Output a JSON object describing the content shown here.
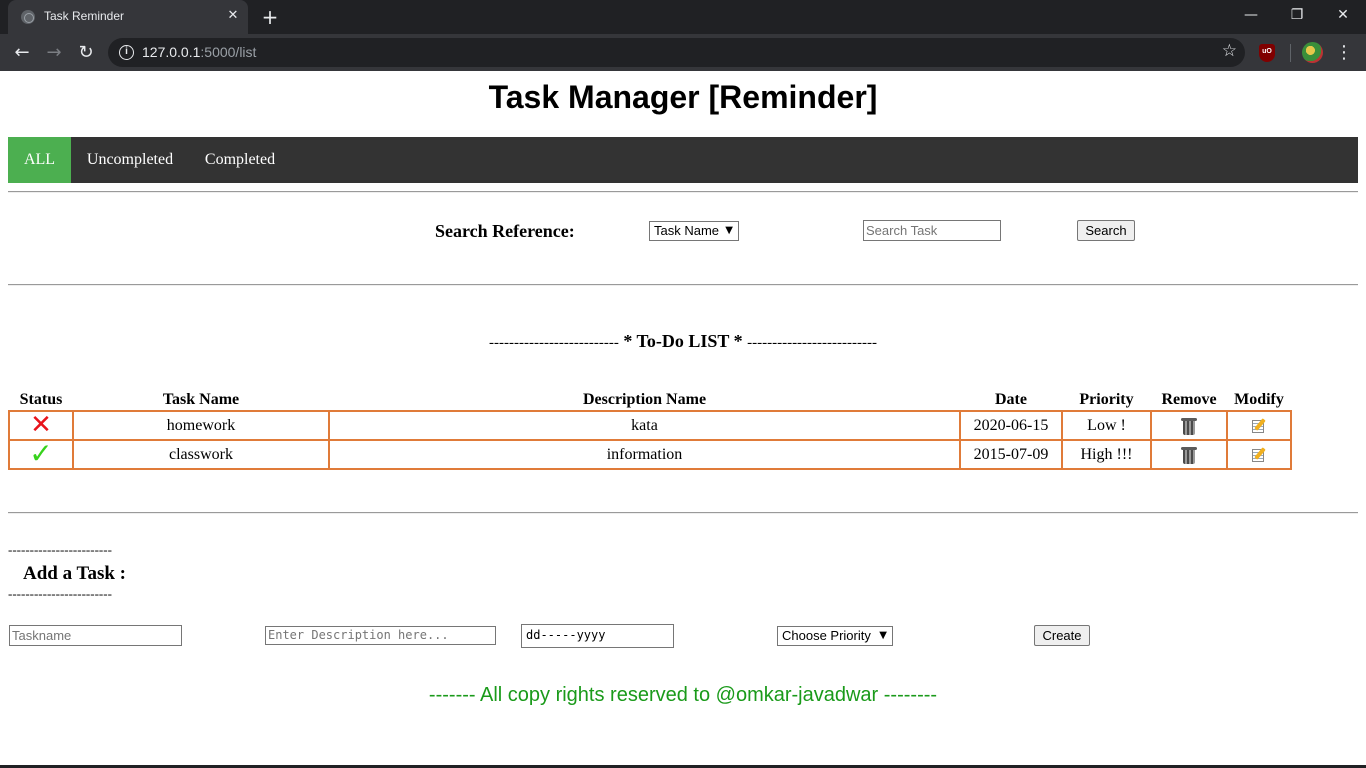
{
  "browser": {
    "tab_title": "Task Reminder",
    "tab_close": "✕",
    "new_tab": "+",
    "window": {
      "minimize": "—",
      "restore": "❐",
      "close": "✕"
    },
    "url_host": "127.0.0.1",
    "url_path": ":5000/list",
    "extension_label": "uO"
  },
  "page": {
    "title": "Task Manager [Reminder]",
    "nav": [
      {
        "label": "ALL",
        "active": true
      },
      {
        "label": "Uncompleted",
        "active": false
      },
      {
        "label": "Completed",
        "active": false
      }
    ],
    "search": {
      "label": "Search Reference:",
      "select_value": "Task Name",
      "input_placeholder": "Search Task",
      "button_label": "Search"
    },
    "todo_heading": {
      "dashes_left": "--------------------------",
      "text": " * To-Do LIST * ",
      "dashes_right": "--------------------------"
    },
    "table": {
      "headers": [
        "Status",
        "Task Name",
        "Description Name",
        "Date",
        "Priority",
        "Remove",
        "Modify"
      ],
      "rows": [
        {
          "status": "uncompleted",
          "status_icon": "cross-icon",
          "task_name": "homework",
          "description": "kata",
          "date": "2020-06-15",
          "priority": "Low !"
        },
        {
          "status": "completed",
          "status_icon": "check-icon",
          "task_name": "classwork",
          "description": "information",
          "date": "2015-07-09",
          "priority": "High !!!"
        }
      ]
    },
    "add_task": {
      "dashes": "------------------------",
      "label": "Add a Task :",
      "taskname_placeholder": "Taskname",
      "description_placeholder": "Enter Description here...",
      "date_value": "dd-----yyyy",
      "priority_value": "Choose Priority",
      "create_label": "Create"
    },
    "footer": "------- All copy rights reserved to @omkar-javadwar --------"
  }
}
